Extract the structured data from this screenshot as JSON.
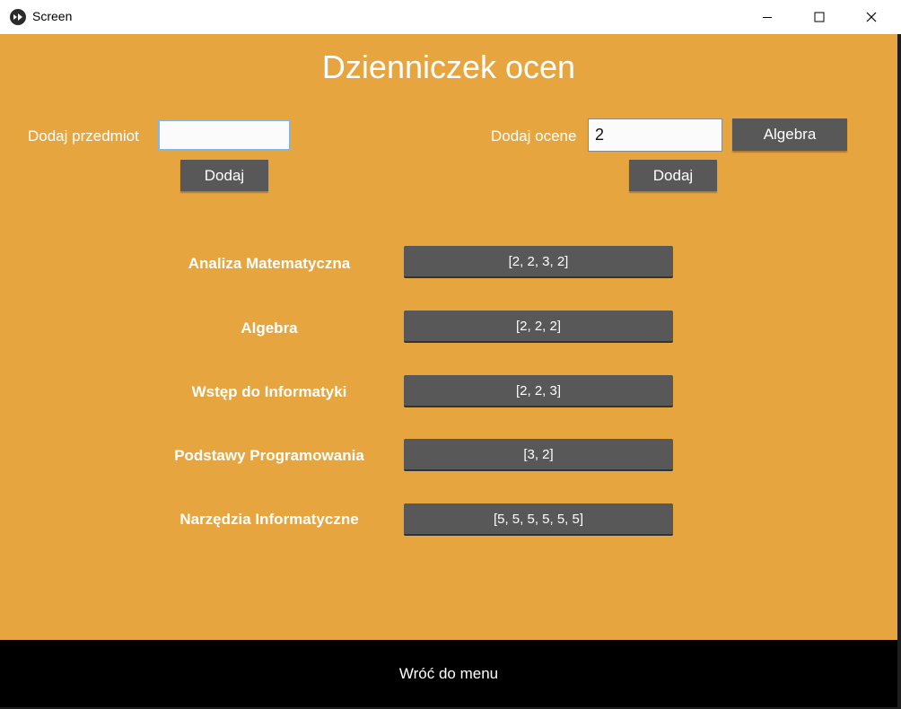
{
  "window": {
    "title": "Screen",
    "icons": {
      "app": "kivy-logo-icon",
      "minimize": "minimize-icon",
      "maximize": "maximize-icon",
      "close": "close-icon"
    }
  },
  "colors": {
    "background": "#e6a53e",
    "button": "#585858",
    "menu_bar": "#000000",
    "text": "#ffffff"
  },
  "heading": "Dzienniczek ocen",
  "add_subject": {
    "label": "Dodaj przedmiot",
    "input_value": "",
    "button_label": "Dodaj"
  },
  "add_grade": {
    "label": "Dodaj ocene",
    "input_value": "2",
    "subject_button_label": "Algebra",
    "button_label": "Dodaj"
  },
  "subjects": [
    {
      "name": "Analiza Matematyczna",
      "grades": "[2, 2, 3, 2]"
    },
    {
      "name": "Algebra",
      "grades": "[2, 2, 2]"
    },
    {
      "name": "Wstęp do Informatyki",
      "grades": "[2, 2, 3]"
    },
    {
      "name": "Podstawy Programowania",
      "grades": "[3, 2]"
    },
    {
      "name": "Narzędzia Informatyczne",
      "grades": "[5, 5, 5, 5, 5, 5]"
    }
  ],
  "footer": {
    "menu_label": "Wróć do menu"
  }
}
